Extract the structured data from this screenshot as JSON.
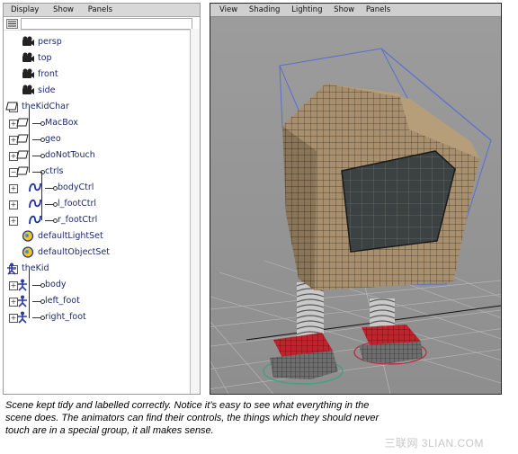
{
  "outliner": {
    "menu": [
      "Display",
      "Show",
      "Panels"
    ],
    "items": [
      {
        "label": "persp",
        "kind": "camera",
        "expand": ""
      },
      {
        "label": "top",
        "kind": "camera",
        "expand": ""
      },
      {
        "label": "front",
        "kind": "camera",
        "expand": ""
      },
      {
        "label": "side",
        "kind": "camera",
        "expand": ""
      },
      {
        "label": "theKidChar",
        "kind": "group",
        "expand": "−"
      },
      {
        "label": "MacBox",
        "kind": "group",
        "expand": "+"
      },
      {
        "label": "geo",
        "kind": "group",
        "expand": "+"
      },
      {
        "label": "doNotTouch",
        "kind": "group",
        "expand": "+"
      },
      {
        "label": "ctrls",
        "kind": "group",
        "expand": "−"
      },
      {
        "label": "bodyCtrl",
        "kind": "curve",
        "expand": "+"
      },
      {
        "label": "l_footCtrl",
        "kind": "curve",
        "expand": "+"
      },
      {
        "label": "r_footCtrl",
        "kind": "curve",
        "expand": "+"
      },
      {
        "label": "defaultLightSet",
        "kind": "set",
        "expand": ""
      },
      {
        "label": "defaultObjectSet",
        "kind": "set",
        "expand": ""
      },
      {
        "label": "theKid",
        "kind": "joint",
        "expand": "−"
      },
      {
        "label": "body",
        "kind": "joint",
        "expand": "+"
      },
      {
        "label": "left_foot",
        "kind": "joint",
        "expand": "+"
      },
      {
        "label": "right_foot",
        "kind": "joint",
        "expand": "+"
      }
    ]
  },
  "viewport": {
    "menu": [
      "View",
      "Shading",
      "Lighting",
      "Show",
      "Panels"
    ]
  },
  "caption": "Scene kept tidy and labelled correctly.  Notice it’s easy to see what everything in the scene does.  The animators can find their controls, the things which they should never touch are in a special group, it all makes sense.",
  "watermark": "三联网 3LIAN.COM",
  "colors": {
    "label": "#1d2a6b",
    "viewport_bg": "#9a9a9a",
    "selection": "#5a6fd0",
    "shoe": "#c0232b"
  }
}
